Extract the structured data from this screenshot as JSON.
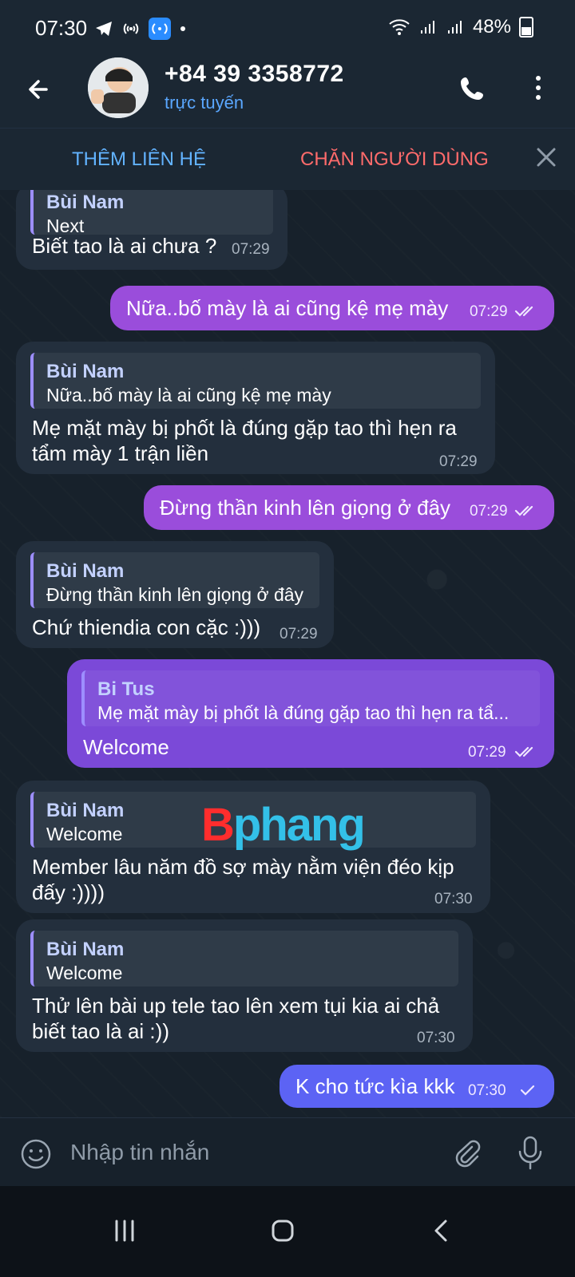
{
  "status_bar": {
    "time": "07:30",
    "battery": "48%"
  },
  "header": {
    "name": "+84 39 3358772",
    "status": "trực tuyến"
  },
  "actions": {
    "add_contact": "THÊM LIÊN HỆ",
    "block_user": "CHẶN NGƯỜI DÙNG"
  },
  "messages": [
    {
      "direction": "incoming",
      "quote_name": "Bùi Nam",
      "quote_text": "Next",
      "text": "Biết tao là ai chưa ?",
      "time": "07:29"
    },
    {
      "direction": "outgoing",
      "text": "Nữa..bố mày là ai cũng kệ mẹ mày",
      "time": "07:29"
    },
    {
      "direction": "incoming",
      "quote_name": "Bùi Nam",
      "quote_text": "Nữa..bố mày là ai cũng kệ mẹ mày",
      "text": "Mẹ mặt mày bị phốt là đúng gặp tao thì hẹn ra tẩm mày 1 trận liền",
      "time": "07:29"
    },
    {
      "direction": "outgoing",
      "text": "Đừng thần kinh lên giọng ở đây",
      "time": "07:29"
    },
    {
      "direction": "incoming",
      "quote_name": "Bùi Nam",
      "quote_text": "Đừng thần kinh lên giọng ở đây",
      "text": "Chứ thiendia con cặc :)))",
      "time": "07:29"
    },
    {
      "direction": "outgoing",
      "quote_name": "Bi Tus",
      "quote_text": "Mẹ mặt mày bị phốt là đúng gặp tao thì hẹn ra tẩ...",
      "text": "Welcome",
      "time": "07:29"
    },
    {
      "direction": "incoming",
      "quote_name": "Bùi Nam",
      "quote_text": "Welcome",
      "text": "Member lâu năm đồ sợ mày nằm viện đéo kịp đấy :))))",
      "time": "07:30"
    },
    {
      "direction": "incoming",
      "quote_name": "Bùi Nam",
      "quote_text": "Welcome",
      "text": "Thử lên bài up tele tao lên xem tụi kia ai chả biết tao là ai :))",
      "time": "07:30"
    },
    {
      "direction": "outgoing",
      "text": "K cho tức kìa kkk",
      "time": "07:30"
    }
  ],
  "composer": {
    "placeholder": "Nhập tin nhắn"
  },
  "watermark": {
    "left": "B",
    "right": "phang"
  },
  "icons": {
    "back": "back-arrow-icon",
    "call": "phone-icon",
    "more": "more-vertical-icon",
    "close": "close-icon",
    "emoji": "emoji-icon",
    "attach": "paperclip-icon",
    "mic": "microphone-icon"
  }
}
